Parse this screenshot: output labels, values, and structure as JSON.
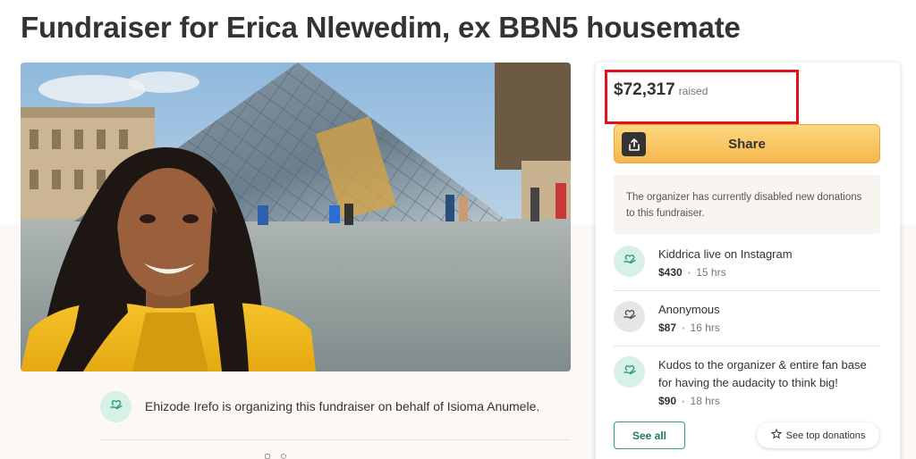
{
  "page": {
    "title": "Fundraiser for Erica Nlewedim, ex BBN5 housemate"
  },
  "organizer": {
    "text": "Ehizode Irefo is organizing this fundraiser on behalf of Isioma Anumele.",
    "icon": "heart-hand-icon"
  },
  "progress": {
    "amount": "$72,317",
    "label": "raised"
  },
  "share": {
    "label": "Share",
    "icon": "share-icon"
  },
  "notice": "The organizer has currently disabled new donations to this fundraiser.",
  "donations": [
    {
      "name": "Kiddrica live on Instagram",
      "amount": "$430",
      "time": "15 hrs",
      "avatar": "heart-hand-icon"
    },
    {
      "name": "Anonymous",
      "amount": "$87",
      "time": "16 hrs",
      "avatar": "heart-hand-icon"
    },
    {
      "name": "Kudos to the organizer & entire fan base for having the audacity to think big!",
      "amount": "$90",
      "time": "18 hrs",
      "avatar": "heart-hand-icon"
    }
  ],
  "buttons": {
    "see_all": "See all",
    "see_top": "See top donations"
  },
  "colors": {
    "share_yellow": "#f5b74c",
    "brand_green": "#2a9f7a",
    "highlight_red": "#e3111a"
  }
}
